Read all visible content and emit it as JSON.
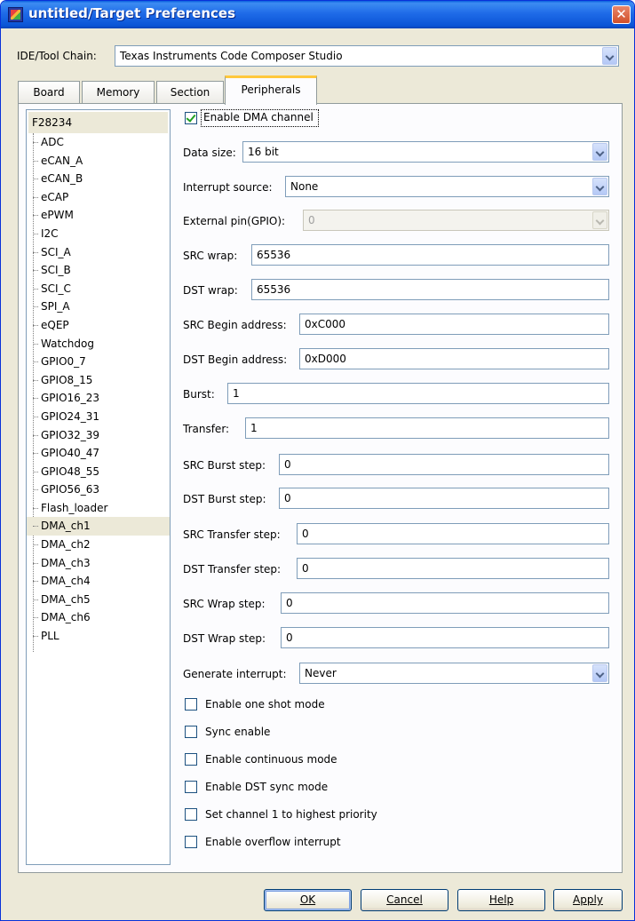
{
  "window": {
    "title": "untitled/Target Preferences",
    "close_glyph": "✕"
  },
  "ide": {
    "label": "IDE/Tool Chain:",
    "value": "Texas Instruments Code Composer Studio"
  },
  "tabs": [
    {
      "label": "Board"
    },
    {
      "label": "Memory"
    },
    {
      "label": "Section"
    },
    {
      "label": "Peripherals"
    }
  ],
  "tree": {
    "root": "F28234",
    "items": [
      "ADC",
      "eCAN_A",
      "eCAN_B",
      "eCAP",
      "ePWM",
      "I2C",
      "SCI_A",
      "SCI_B",
      "SCI_C",
      "SPI_A",
      "eQEP",
      "Watchdog",
      "GPIO0_7",
      "GPIO8_15",
      "GPIO16_23",
      "GPIO24_31",
      "GPIO32_39",
      "GPIO40_47",
      "GPIO48_55",
      "GPIO56_63",
      "Flash_loader",
      "DMA_ch1",
      "DMA_ch2",
      "DMA_ch3",
      "DMA_ch4",
      "DMA_ch5",
      "DMA_ch6",
      "PLL"
    ],
    "selected": "DMA_ch1"
  },
  "form": {
    "enable_dma": {
      "label": "Enable DMA channel",
      "checked": true
    },
    "data_size": {
      "label": "Data size:",
      "value": "16 bit"
    },
    "interrupt_source": {
      "label": "Interrupt source:",
      "value": "None"
    },
    "external_pin": {
      "label": "External pin(GPIO):",
      "value": "0"
    },
    "src_wrap": {
      "label": "SRC wrap:",
      "value": "65536"
    },
    "dst_wrap": {
      "label": "DST wrap:",
      "value": "65536"
    },
    "src_begin": {
      "label": "SRC Begin address:",
      "value": "0xC000"
    },
    "dst_begin": {
      "label": "DST Begin address:",
      "value": "0xD000"
    },
    "burst": {
      "label": "Burst:",
      "value": "1"
    },
    "transfer": {
      "label": "Transfer:",
      "value": "1"
    },
    "src_burst_step": {
      "label": "SRC Burst step:",
      "value": "0"
    },
    "dst_burst_step": {
      "label": "DST Burst step:",
      "value": "0"
    },
    "src_transfer_step": {
      "label": "SRC Transfer step:",
      "value": "0"
    },
    "dst_transfer_step": {
      "label": "DST Transfer step:",
      "value": "0"
    },
    "src_wrap_step": {
      "label": "SRC Wrap step:",
      "value": "0"
    },
    "dst_wrap_step": {
      "label": "DST Wrap step:",
      "value": "0"
    },
    "generate_interrupt": {
      "label": "Generate interrupt:",
      "value": "Never"
    },
    "checkboxes": [
      {
        "label": "Enable one shot mode",
        "checked": false
      },
      {
        "label": "Sync enable",
        "checked": false
      },
      {
        "label": "Enable continuous mode",
        "checked": false
      },
      {
        "label": "Enable DST sync mode",
        "checked": false
      },
      {
        "label": "Set channel 1 to highest priority",
        "checked": false
      },
      {
        "label": "Enable overflow interrupt",
        "checked": false
      }
    ]
  },
  "buttons": {
    "ok": "OK",
    "cancel": "Cancel",
    "help": "Help",
    "apply": "Apply"
  }
}
